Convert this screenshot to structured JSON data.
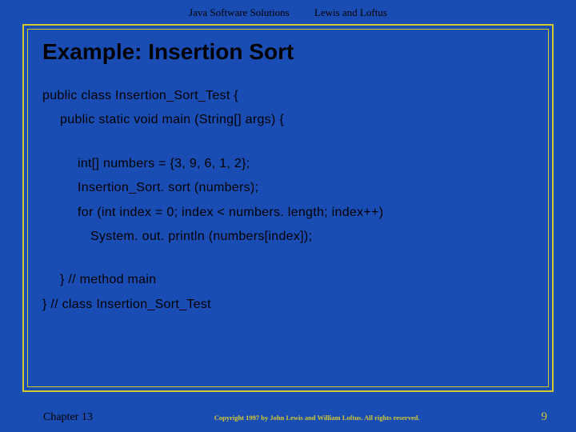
{
  "header": {
    "book": "Java Software Solutions",
    "authors": "Lewis and Loftus"
  },
  "title": "Example: Insertion Sort",
  "code": {
    "line1": "public class Insertion_Sort_Test {",
    "line2": "public static void main (String[] args) {",
    "line3": "int[] numbers = {3, 9, 6, 1, 2};",
    "line4": "Insertion_Sort. sort (numbers);",
    "line5": "for (int index = 0; index < numbers. length; index++)",
    "line6": "System. out. println (numbers[index]);",
    "line7": "}  // method main",
    "line8": "}  // class Insertion_Sort_Test"
  },
  "footer": {
    "chapter": "Chapter 13",
    "copyright": "Copyright 1997 by John Lewis and William Loftus.  All rights reserved.",
    "page": "9"
  }
}
